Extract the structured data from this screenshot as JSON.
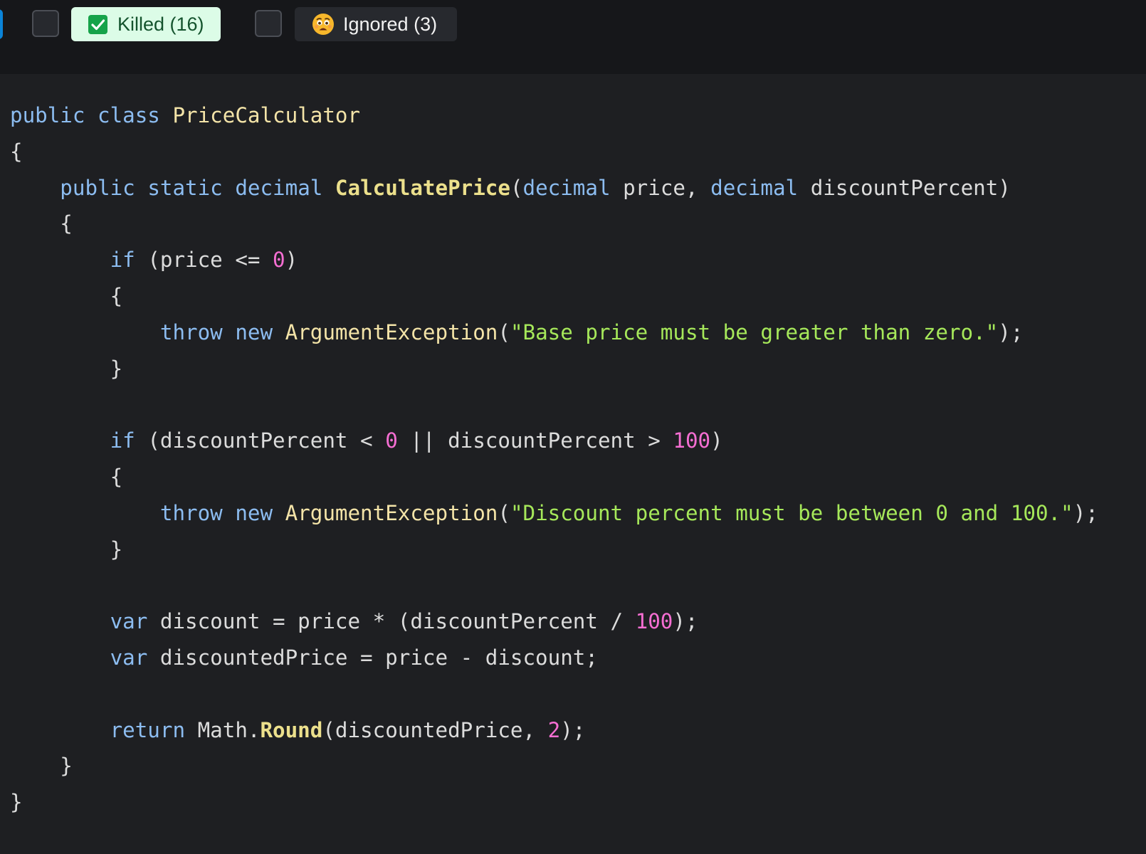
{
  "filters": {
    "killed": {
      "checked": true,
      "label": "Killed (16)",
      "icon": "check-box-icon"
    },
    "ignored": {
      "checked": false,
      "label": "Ignored (3)",
      "icon": "worried-face-emoji-icon"
    }
  },
  "colors": {
    "toolbar_bg": "#16171a",
    "editor_bg": "#1e1f22",
    "killed_chip_bg": "#dcfce7",
    "check_green": "#16a34a",
    "keyword": "#8cbcf0",
    "type_name": "#f4e4a8",
    "method": "#ece08c",
    "number": "#f56ed2",
    "string": "#a6e85a",
    "plain": "#dcdcdc"
  },
  "code": {
    "language": "C#",
    "lines": [
      [
        {
          "t": "public",
          "k": "keyword"
        },
        {
          "t": " "
        },
        {
          "t": "class",
          "k": "keyword"
        },
        {
          "t": " "
        },
        {
          "t": "PriceCalculator",
          "k": "type"
        }
      ],
      [
        {
          "t": "{"
        }
      ],
      [
        {
          "t": "    "
        },
        {
          "t": "public",
          "k": "keyword"
        },
        {
          "t": " "
        },
        {
          "t": "static",
          "k": "keyword"
        },
        {
          "t": " "
        },
        {
          "t": "decimal",
          "k": "keyword"
        },
        {
          "t": " "
        },
        {
          "t": "CalculatePrice",
          "k": "method"
        },
        {
          "t": "("
        },
        {
          "t": "decimal",
          "k": "keyword"
        },
        {
          "t": " price, "
        },
        {
          "t": "decimal",
          "k": "keyword"
        },
        {
          "t": " discountPercent)"
        }
      ],
      [
        {
          "t": "    {"
        }
      ],
      [
        {
          "t": "        "
        },
        {
          "t": "if",
          "k": "keyword"
        },
        {
          "t": " (price <= "
        },
        {
          "t": "0",
          "k": "number"
        },
        {
          "t": ")"
        }
      ],
      [
        {
          "t": "        {"
        }
      ],
      [
        {
          "t": "            "
        },
        {
          "t": "throw",
          "k": "keyword"
        },
        {
          "t": " "
        },
        {
          "t": "new",
          "k": "keyword"
        },
        {
          "t": " "
        },
        {
          "t": "ArgumentException",
          "k": "type"
        },
        {
          "t": "("
        },
        {
          "t": "\"Base price must be greater than zero.\"",
          "k": "string"
        },
        {
          "t": ");"
        }
      ],
      [
        {
          "t": "        }"
        }
      ],
      [],
      [
        {
          "t": "        "
        },
        {
          "t": "if",
          "k": "keyword"
        },
        {
          "t": " (discountPercent < "
        },
        {
          "t": "0",
          "k": "number"
        },
        {
          "t": " || discountPercent > "
        },
        {
          "t": "100",
          "k": "number"
        },
        {
          "t": ")"
        }
      ],
      [
        {
          "t": "        {"
        }
      ],
      [
        {
          "t": "            "
        },
        {
          "t": "throw",
          "k": "keyword"
        },
        {
          "t": " "
        },
        {
          "t": "new",
          "k": "keyword"
        },
        {
          "t": " "
        },
        {
          "t": "ArgumentException",
          "k": "type"
        },
        {
          "t": "("
        },
        {
          "t": "\"Discount percent must be between 0 and 100.\"",
          "k": "string"
        },
        {
          "t": ");"
        }
      ],
      [
        {
          "t": "        }"
        }
      ],
      [],
      [
        {
          "t": "        "
        },
        {
          "t": "var",
          "k": "keyword"
        },
        {
          "t": " discount = price * (discountPercent / "
        },
        {
          "t": "100",
          "k": "number"
        },
        {
          "t": ");"
        }
      ],
      [
        {
          "t": "        "
        },
        {
          "t": "var",
          "k": "keyword"
        },
        {
          "t": " discountedPrice = price - discount;"
        }
      ],
      [],
      [
        {
          "t": "        "
        },
        {
          "t": "return",
          "k": "keyword"
        },
        {
          "t": " Math."
        },
        {
          "t": "Round",
          "k": "method"
        },
        {
          "t": "(discountedPrice, "
        },
        {
          "t": "2",
          "k": "number"
        },
        {
          "t": ");"
        }
      ],
      [
        {
          "t": "    }"
        }
      ],
      [
        {
          "t": "}"
        }
      ]
    ]
  }
}
